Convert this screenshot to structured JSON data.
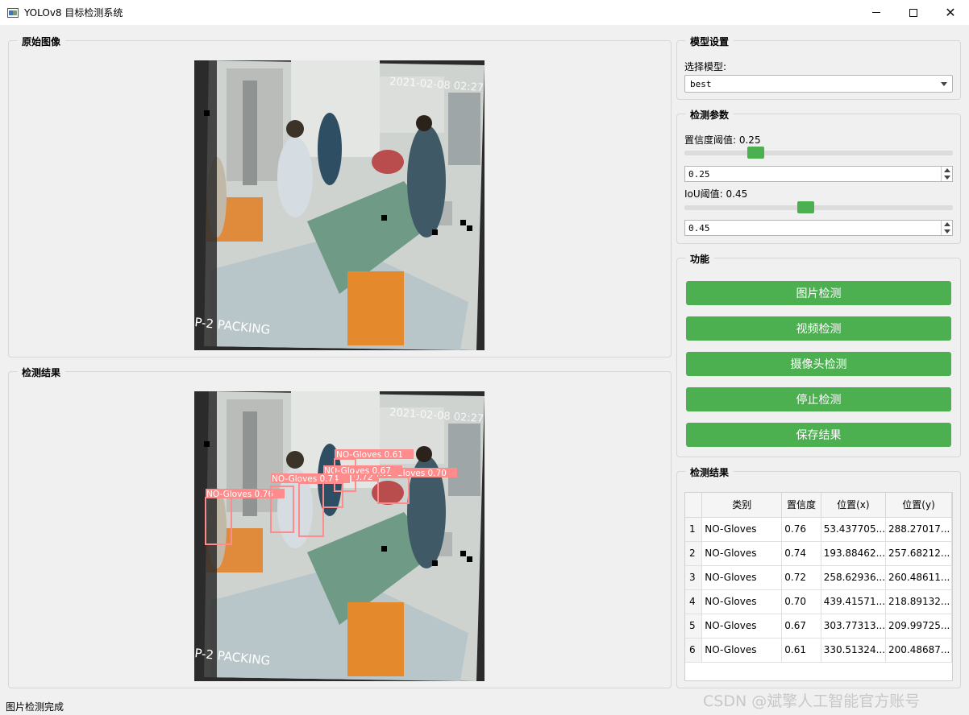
{
  "window": {
    "title": "YOLOv8 目标检测系统",
    "minimize": "—",
    "maximize": "☐",
    "close": "✕"
  },
  "original_panel": {
    "title": "原始图像"
  },
  "result_panel": {
    "title": "检测结果"
  },
  "scene_text": {
    "timestamp": "2021-02-08 02:27:08",
    "packing": "P-2 PACKING"
  },
  "model_settings": {
    "title": "模型设置",
    "select_label": "选择模型:",
    "selected_model": "best"
  },
  "params": {
    "title": "检测参数",
    "conf_label": "置信度阈值: 0.25",
    "conf_value": "0.25",
    "conf_slider_fraction": 0.25,
    "iou_label": "IoU阈值: 0.45",
    "iou_value": "0.45",
    "iou_slider_fraction": 0.45
  },
  "functions": {
    "title": "功能",
    "buttons": [
      "图片检测",
      "视频检测",
      "摄像头检测",
      "停止检测",
      "保存结果"
    ]
  },
  "results_table": {
    "title": "检测结果",
    "headers": [
      "类别",
      "置信度",
      "位置(x)",
      "位置(y)"
    ],
    "rows": [
      [
        "1",
        "NO-Gloves",
        "0.76",
        "53.437705...",
        "288.27017..."
      ],
      [
        "2",
        "NO-Gloves",
        "0.74",
        "193.88462...",
        "257.68212..."
      ],
      [
        "3",
        "NO-Gloves",
        "0.72",
        "258.62936...",
        "260.48611..."
      ],
      [
        "4",
        "NO-Gloves",
        "0.70",
        "439.41571...",
        "218.89132..."
      ],
      [
        "5",
        "NO-Gloves",
        "0.67",
        "303.77313...",
        "209.99725..."
      ],
      [
        "6",
        "NO-Gloves",
        "0.61",
        "330.51324...",
        "200.48687..."
      ]
    ]
  },
  "detections": [
    {
      "label": "NO-Gloves 0.76"
    },
    {
      "label": "NO-Gloves 0.74"
    },
    {
      "label": "0.72"
    },
    {
      "label": "NO-Gloves 0.70"
    },
    {
      "label": "NO-Gloves 0.67"
    },
    {
      "label": "NO-Gloves 0.61"
    }
  ],
  "colors": {
    "accent": "#4caf50",
    "box": "#ff8c8c"
  },
  "status": {
    "text": "图片检测完成"
  },
  "watermark": {
    "text": "CSDN @斌擎人工智能官方账号"
  }
}
